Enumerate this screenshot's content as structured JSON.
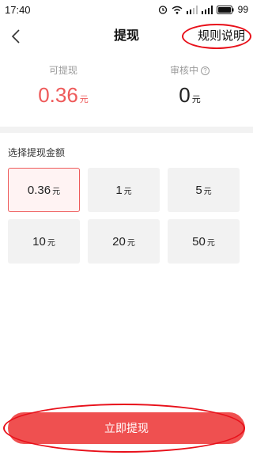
{
  "status_bar": {
    "time": "17:40",
    "battery": "99"
  },
  "nav": {
    "title": "提现",
    "rules_label": "规则说明"
  },
  "balance": {
    "withdrawable": {
      "label": "可提现",
      "value": "0.36",
      "unit": "元"
    },
    "pending": {
      "label": "审核中",
      "value": "0",
      "unit": "元"
    }
  },
  "amount_section": {
    "title": "选择提现金额",
    "options": [
      {
        "value": "0.36",
        "unit": "元",
        "selected": true
      },
      {
        "value": "1",
        "unit": "元",
        "selected": false
      },
      {
        "value": "5",
        "unit": "元",
        "selected": false
      },
      {
        "value": "10",
        "unit": "元",
        "selected": false
      },
      {
        "value": "20",
        "unit": "元",
        "selected": false
      },
      {
        "value": "50",
        "unit": "元",
        "selected": false
      }
    ]
  },
  "withdraw_button": {
    "label": "立即提现"
  },
  "colors": {
    "accent": "#ef5050",
    "annotation": "#e8101a",
    "tile": "#f2f2f2"
  }
}
